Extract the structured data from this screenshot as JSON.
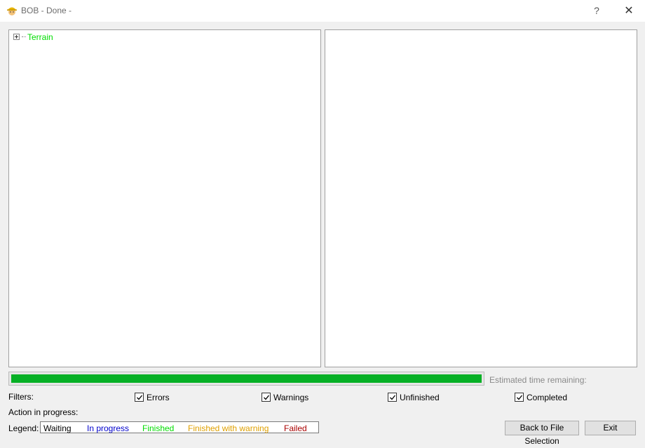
{
  "window": {
    "title": "BOB - Done -",
    "help_label": "?",
    "close_label": "✕"
  },
  "tree": {
    "items": [
      {
        "label": "Terrain",
        "color": "#00dd00"
      }
    ]
  },
  "progress": {
    "value": 1.0,
    "eta_label": "Estimated time remaining:"
  },
  "filters": {
    "label": "Filters:",
    "options": [
      {
        "label": "Errors",
        "checked": true
      },
      {
        "label": "Warnings",
        "checked": true
      },
      {
        "label": "Unfinished",
        "checked": true
      },
      {
        "label": "Completed",
        "checked": true
      }
    ]
  },
  "action": {
    "label": "Action in progress:"
  },
  "legend": {
    "label": "Legend:",
    "items": [
      {
        "label": "Waiting",
        "color": "#000000"
      },
      {
        "label": "In progress",
        "color": "#0000cc"
      },
      {
        "label": "Finished",
        "color": "#00dd00"
      },
      {
        "label": "Finished with warning",
        "color": "#e0a000"
      },
      {
        "label": "Failed",
        "color": "#aa0000"
      }
    ]
  },
  "buttons": {
    "back_label": "Back to File Selection",
    "exit_label": "Exit"
  }
}
